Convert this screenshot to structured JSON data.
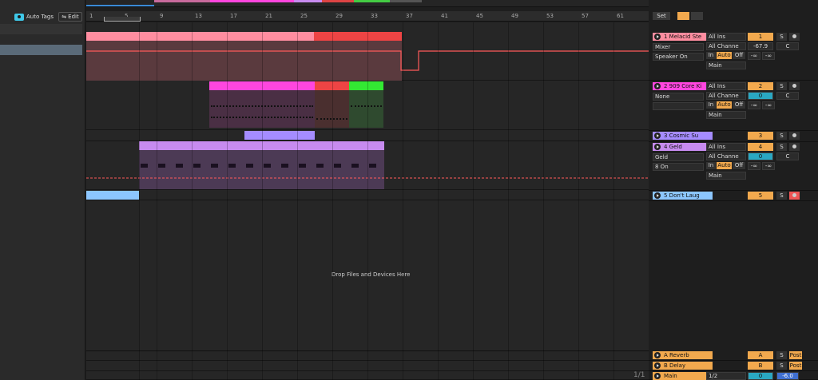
{
  "browser": {
    "auto_tags": "Auto Tags",
    "edit": "Edit"
  },
  "ruler": {
    "bars": [
      "1",
      "5",
      "9",
      "13",
      "17",
      "21",
      "25",
      "29",
      "33",
      "37",
      "41",
      "45",
      "49",
      "53",
      "57",
      "61"
    ]
  },
  "arrangement": {
    "drop_hint": "Drop Files and Devices Here"
  },
  "header": {
    "set": "Set"
  },
  "tracks": [
    {
      "name": "1 Melacid Ste",
      "color": "#ff8da0",
      "num": "1",
      "input_type": "All Ins",
      "input_channel": "All Channe",
      "device": "Mixer",
      "param": "Speaker On",
      "monitor_in": "In",
      "monitor_auto": "Auto",
      "monitor_off": "Off",
      "output": "Main",
      "volume": "-67.9",
      "pan": "C",
      "send_a": "-∞",
      "send_b": "-∞"
    },
    {
      "name": "2 909 Core Ki",
      "color": "#ff46df",
      "num": "2",
      "input_type": "All Ins",
      "input_channel": "All Channe",
      "device": "None",
      "monitor_in": "In",
      "monitor_auto": "Auto",
      "monitor_off": "Off",
      "output": "Main",
      "volume": "0",
      "pan": "C",
      "send_a": "-∞",
      "send_b": "-∞"
    },
    {
      "name": "3 Cosmic Su",
      "color": "#a58cff",
      "num": "3"
    },
    {
      "name": "4 Geld",
      "color": "#c78bef",
      "num": "4",
      "input_type": "All Ins",
      "input_channel": "All Channe",
      "device": "Geld",
      "param": "8 On",
      "monitor_in": "In",
      "monitor_auto": "Auto",
      "monitor_off": "Off",
      "output": "Main",
      "volume": "0",
      "pan": "C",
      "send_a": "-∞",
      "send_b": "-∞"
    },
    {
      "name": "5 Don't Laug",
      "color": "#8cc6ff",
      "num": "5"
    }
  ],
  "returns": [
    {
      "name": "A Reverb",
      "color": "#f2a94e",
      "num": "A",
      "post": "Post"
    },
    {
      "name": "B Delay",
      "color": "#f2a94e",
      "num": "B",
      "post": "Post"
    }
  ],
  "master": {
    "name": "Main",
    "output": "1/2",
    "num": "0",
    "volume": "-6.0"
  },
  "pagination": "1/1",
  "colors": {
    "accent": "#f2a94e",
    "blue_value": "#2aa7c2"
  }
}
